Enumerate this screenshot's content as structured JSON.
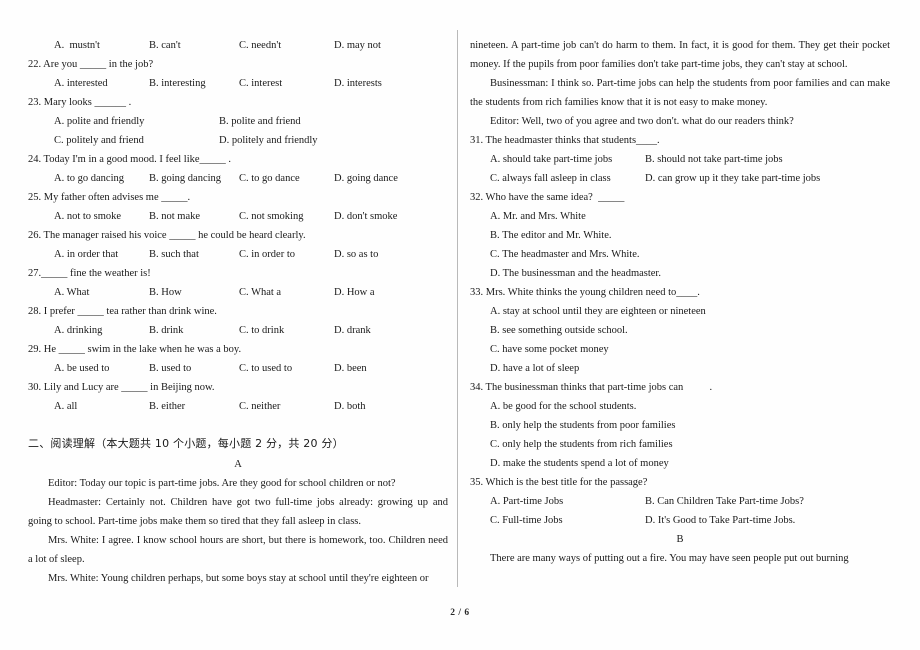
{
  "page": {
    "footer": "2 / 6",
    "divider_color": "#b9b9b9"
  },
  "left_column": {
    "q21_options": {
      "a": "A.  mustn't",
      "b": "B. can't",
      "c": "C. needn't",
      "d": "D. may not"
    },
    "q22": {
      "stem": "22. Are you _____ in the job?",
      "a": "A. interested",
      "b": "B. interesting",
      "c": "C. interest",
      "d": "D. interests"
    },
    "q23": {
      "stem": "23. Mary looks ______ .",
      "a": "A. polite and friendly",
      "b": "B. polite and friend",
      "c": "C. politely and friend",
      "d": "D. politely and friendly"
    },
    "q24": {
      "stem": "24. Today I'm in a good mood. I feel like_____ .",
      "a": "A. to go dancing",
      "b": "B. going dancing",
      "c": "C. to go dance",
      "d": "D. going dance"
    },
    "q25": {
      "stem": "25. My father often advises me _____.",
      "a": "A. not to smoke",
      "b": "B. not make",
      "c": "C. not smoking",
      "d": "D. don't smoke"
    },
    "q26": {
      "stem": "26. The manager raised his voice _____ he could be heard clearly.",
      "a": "A. in order that",
      "b": "B. such that",
      "c": "C. in order to",
      "d": "D. so as to"
    },
    "q27": {
      "stem": "27._____ fine the weather is!",
      "a": "A. What",
      "b": "B. How",
      "c": "C. What a",
      "d": "D. How a"
    },
    "q28": {
      "stem": "28. I prefer _____ tea rather than drink wine.",
      "a": "A. drinking",
      "b": "B. drink",
      "c": "C. to drink",
      "d": "D. drank"
    },
    "q29": {
      "stem": "29. He _____ swim in the lake when he was a boy.",
      "a": "A. be used to",
      "b": "B. used to",
      "c": "C. to used to",
      "d": "D. been"
    },
    "q30": {
      "stem": "30. Lily and Lucy are _____ in Beijing now.",
      "a": "A. all",
      "b": "B. either",
      "c": "C. neither",
      "d": "D. both"
    },
    "section_two_heading": "二、阅读理解（本大题共 10 个小题，每小题 2 分，共 20 分）",
    "passage_a_label": "A",
    "passage_a": {
      "line_editor": "Editor:  Today our topic is part-time jobs. Are they good for school children or not?",
      "line_headmaster": "Headmaster: Certainly not. Children have got two full-time jobs already: growing up and going to school. Part-time jobs make them so tired that they fall asleep in class.",
      "line_mrs_white_1": "Mrs. White: I agree. I know school hours are short, but there is homework, too. Children need a lot of sleep.",
      "line_mrs_white_2": "Mrs. White: Young children perhaps, but some boys stay at school until they're eighteen or"
    }
  },
  "right_column": {
    "passage_a_cont": {
      "para_1": "nineteen. A part-time job can't do harm to them. In fact, it is good for them. They get their pocket money. If the pupils from poor families don't take part-time jobs, they can't stay at school.",
      "para_2": "Businessman: I think so. Part-time jobs can help the students from poor families and can make the students from rich families know that it is not easy to make money.",
      "para_3": "Editor: Well, two of you agree and two don't. what do our readers think?"
    },
    "q31": {
      "stem": "31. The headmaster thinks that students____.",
      "a": "A. should take part-time jobs",
      "b": "B. should not take part-time jobs",
      "c": "C. always fall asleep in class",
      "d": "D. can grow up it they take part-time jobs"
    },
    "q32": {
      "stem": "32. Who have the same idea?  _____",
      "a": "A. Mr. and Mrs. White",
      "b": "B. The editor and Mr. White.",
      "c": "C. The headmaster and Mrs. White.",
      "d": "D. The businessman and the headmaster."
    },
    "q33": {
      "stem": "33. Mrs. White thinks the young children need to____.",
      "a": "A. stay at school until they are eighteen or nineteen",
      "b": "B. see something outside school.",
      "c": "C. have some pocket money",
      "d": "D. have a lot of sleep"
    },
    "q34": {
      "stem": "34. The businessman thinks that part-time jobs can          .",
      "a": "A. be good for the school students.",
      "b": "B. only help the students from poor families",
      "c": "C. only help the students from rich families",
      "d": "D. make the students spend a lot of money"
    },
    "q35": {
      "stem": "35. Which is the best title for the passage?",
      "a": "A. Part-time Jobs",
      "b": "B. Can Children Take Part-time Jobs?",
      "c": "C. Full-time Jobs",
      "d": "D. It's Good to Take Part-time Jobs."
    },
    "passage_b_label": "B",
    "passage_b": {
      "para_1": "There are many ways of putting out a fire. You may have seen people put out burning"
    }
  }
}
